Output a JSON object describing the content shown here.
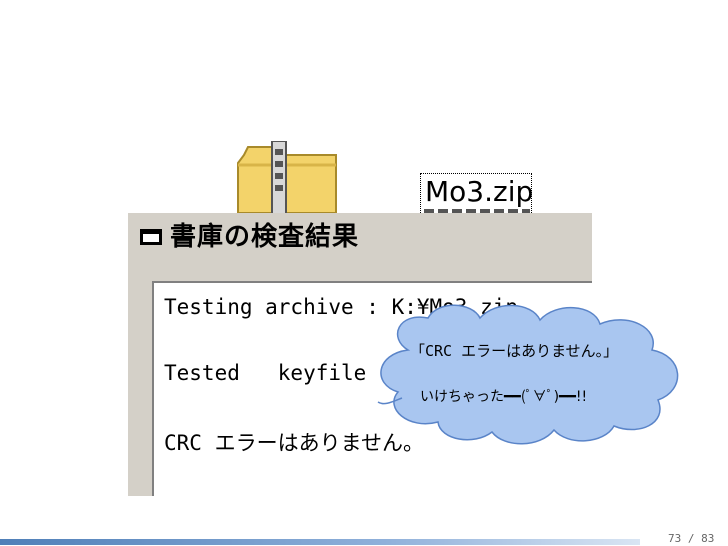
{
  "desktop": {
    "zip_file_label": "Mo3.zip"
  },
  "dialog": {
    "title": "書庫の検査結果",
    "lines": [
      "Testing archive : K:¥Mo3.zip",
      "Tested   keyfile",
      "CRC エラーはありません。"
    ]
  },
  "callout": {
    "line1": "「CRC エラーはありません。」",
    "line2": "いけちゃった━━(ﾟ∀ﾟ)━━!!",
    "fill": "#a9c6f0",
    "stroke": "#5a84c8"
  },
  "footer": {
    "page_indicator": "73 / 83"
  }
}
